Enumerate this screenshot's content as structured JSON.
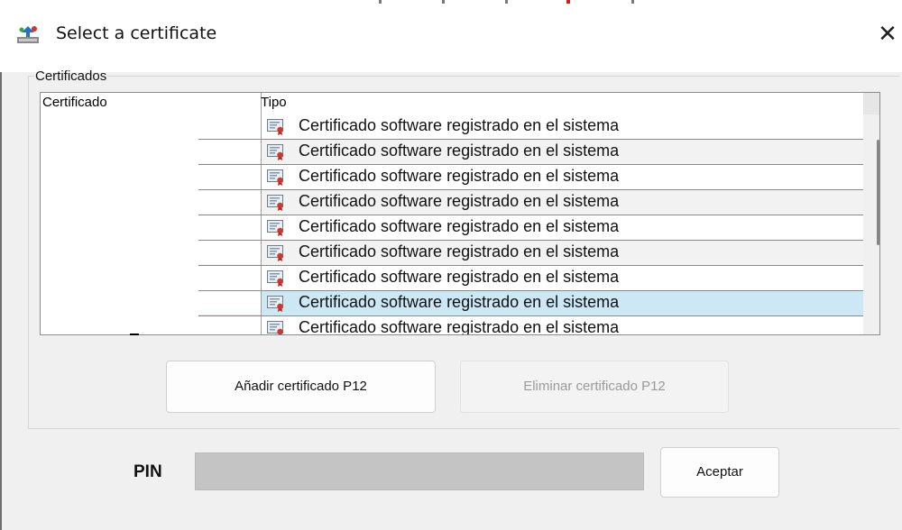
{
  "window": {
    "title": "Select a certificate",
    "close_glyph": "✕"
  },
  "certificates": {
    "group_label": "Certificados",
    "columns": [
      "Certificado",
      "Tipo"
    ],
    "rows": [
      {
        "tipo": "Certificado software registrado en el sistema",
        "icon": "certificate-icon",
        "state": "normal"
      },
      {
        "tipo": "Certificado software registrado en el sistema",
        "icon": "certificate-icon",
        "state": "alt"
      },
      {
        "tipo": "Certificado software registrado en el sistema",
        "icon": "certificate-icon",
        "state": "normal"
      },
      {
        "tipo": "Certificado software registrado en el sistema",
        "icon": "certificate-icon",
        "state": "alt"
      },
      {
        "tipo": "Certificado software registrado en el sistema",
        "icon": "certificate-icon",
        "state": "normal"
      },
      {
        "tipo": "Certificado software registrado en el sistema",
        "icon": "certificate-icon",
        "state": "alt"
      },
      {
        "tipo": "Certificado software registrado en el sistema",
        "icon": "certificate-icon",
        "state": "normal"
      },
      {
        "tipo": "Certificado software registrado en el sistema",
        "icon": "certificate-icon",
        "state": "selected"
      },
      {
        "tipo": "Certificado software registrado en el sistema",
        "icon": "certificate-icon",
        "state": "normal"
      }
    ],
    "add_button": "Añadir certificado P12",
    "delete_button": "Eliminar certificado P12"
  },
  "pin": {
    "label": "PIN",
    "value": "",
    "accept_button": "Aceptar"
  },
  "colors": {
    "selected_row": "#cce8f4",
    "alt_row": "#f2f2f2",
    "dialog_bg": "#f0f0f0",
    "pin_field": "#c4c4c4"
  }
}
